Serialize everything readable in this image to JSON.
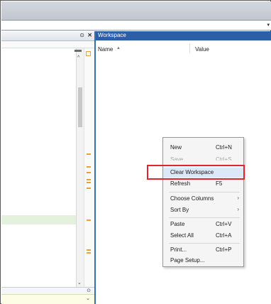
{
  "address_bar": {
    "dropdown_icon": "chevron-down-icon"
  },
  "editor": {
    "minimize_glyph": "⊙",
    "close_glyph": "✕",
    "footer_glyph": "⊙",
    "scroll_up_glyph": "^",
    "scroll_down_glyph": "⌄",
    "bottom_chevron_glyph": "⌄"
  },
  "workspace": {
    "title": "Workspace",
    "columns": {
      "name": "Name",
      "name_sort_indicator": "▲",
      "value": "Value"
    }
  },
  "context_menu": {
    "items": [
      {
        "label": "New",
        "shortcut": "Ctrl+N",
        "state": "enabled"
      },
      {
        "label": "Save",
        "shortcut": "Ctrl+S",
        "state": "disabled"
      },
      {
        "label": "Clear Workspace",
        "shortcut": "",
        "state": "hovered"
      },
      {
        "label": "Refresh",
        "shortcut": "F5",
        "state": "enabled"
      },
      {
        "label": "Choose Columns",
        "shortcut": "",
        "submenu": "›",
        "state": "enabled"
      },
      {
        "label": "Sort By",
        "shortcut": "",
        "submenu": "›",
        "state": "enabled"
      },
      {
        "label": "Paste",
        "shortcut": "Ctrl+V",
        "state": "enabled"
      },
      {
        "label": "Select All",
        "shortcut": "Ctrl+A",
        "state": "enabled"
      },
      {
        "label": "Print...",
        "shortcut": "Ctrl+P",
        "state": "enabled"
      },
      {
        "label": "Page Setup...",
        "shortcut": "",
        "state": "enabled"
      }
    ]
  },
  "colors": {
    "workspace_title_bg": "#2d5fa8",
    "highlight_box": "#e0262b",
    "editor_marker": "#f0a030",
    "highlighted_line": "#e4f1dc"
  }
}
